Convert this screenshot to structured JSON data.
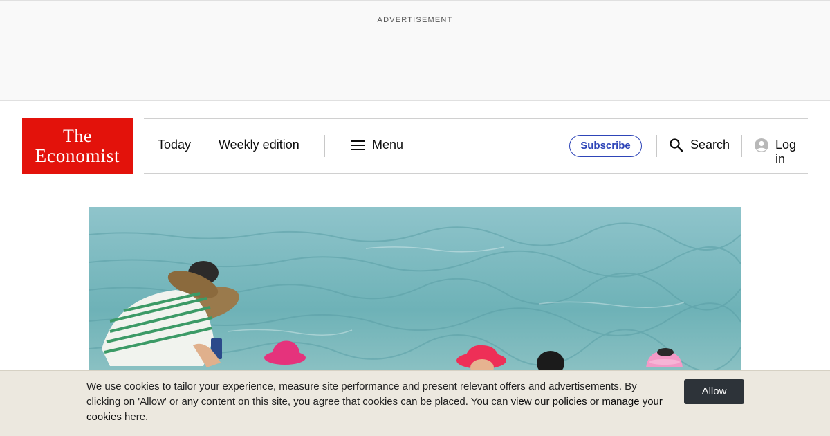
{
  "ad": {
    "label": "ADVERTISEMENT"
  },
  "header": {
    "logo": {
      "line1": "The",
      "line2": "Economist"
    },
    "nav": {
      "today": "Today",
      "weekly": "Weekly edition",
      "menu": "Menu"
    },
    "subscribe": "Subscribe",
    "search": "Search",
    "login": "Log in"
  },
  "icons": {
    "menu": "hamburger-menu-icon",
    "search": "search-icon",
    "user": "user-avatar-icon"
  },
  "colors": {
    "brand_red": "#e3120b",
    "subscribe_blue": "#2e45b8",
    "cookie_bg": "#ece8df",
    "allow_btn": "#2d3339"
  },
  "cookie": {
    "text1": "We use cookies to tailor your experience, measure site performance and present relevant offers and advertisements. By clicking on 'Allow' or any content on this site, you agree that cookies can be placed. You can ",
    "link1": "view our policies",
    "text2": " or ",
    "link2": "manage your cookies",
    "text3": " here.",
    "allow": "Allow"
  }
}
